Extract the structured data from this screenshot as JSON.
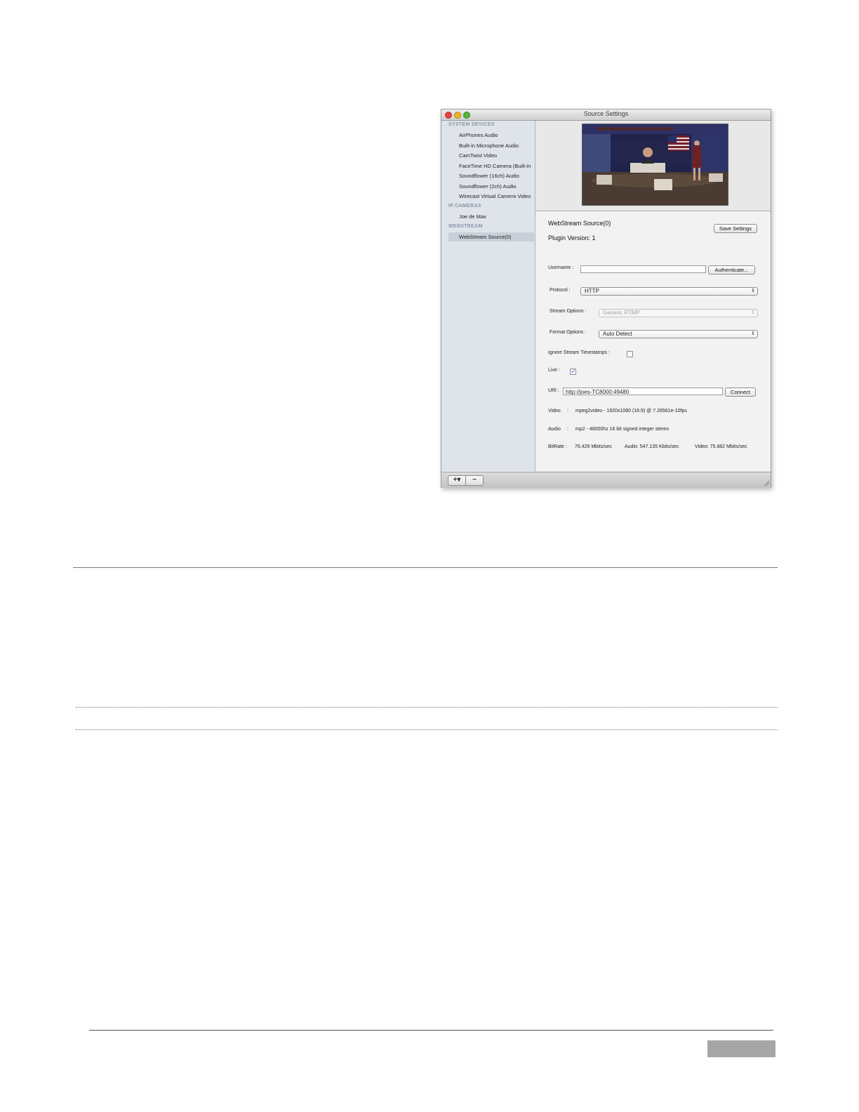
{
  "window": {
    "title": "Source Settings"
  },
  "sidebar": {
    "sections": [
      {
        "heading": "SYSTEM DEVICES",
        "items": [
          "AirPhones Audio",
          "Built-in Microphone Audio",
          "CamTwist Video",
          "FaceTime HD Camera (Built-in",
          "Soundflower (16ch) Audio",
          "Soundflower (2ch) Audio",
          "Wirecast Virtual Camera Video"
        ]
      },
      {
        "heading": "IP CAMERAS",
        "items": [
          "Joe de Max"
        ]
      },
      {
        "heading": "WEBSTREAM",
        "items": [
          "WebStream Source(0)"
        ]
      }
    ],
    "selected": "WebStream Source(0)"
  },
  "settings": {
    "source_name": "WebStream Source(0)",
    "plugin_version": "Plugin Version: 1",
    "save_button": "Save Settings",
    "username_label": "Username :",
    "username_value": "",
    "authenticate_button": "Authenticate...",
    "protocol_label": "Protocol :",
    "protocol_value": "HTTP",
    "stream_options_label": "Stream Options :",
    "stream_options_value": "Generic RTMP",
    "format_options_label": "Format Options :",
    "format_options_value": "Auto Detect",
    "ignore_timestamps_label": "Ignore Stream Timestamps :",
    "ignore_timestamps_checked": false,
    "live_label": "Live :",
    "live_checked": true,
    "url_label": "URl :",
    "url_value": "http://joes-TC8000:49480",
    "connect_button": "Connect",
    "video_label": "Video",
    "video_value": "mpeg2video - 1920x1080 (16:9) @ 7.26561e-10fps",
    "audio_label": "Audio",
    "audio_value": "mp2 - 48000hz 16 bit signed integer stereo",
    "bitrate_label": "BitRate :",
    "bitrate_total": "76.429 Mbits/sec",
    "bitrate_audio": "Audio: 547.135 Kbits/sec",
    "bitrate_video": "Video: 75.882 Mbits/sec",
    "separator": ":"
  },
  "bottombar": {
    "add_label": "+▾",
    "remove_label": "−"
  }
}
